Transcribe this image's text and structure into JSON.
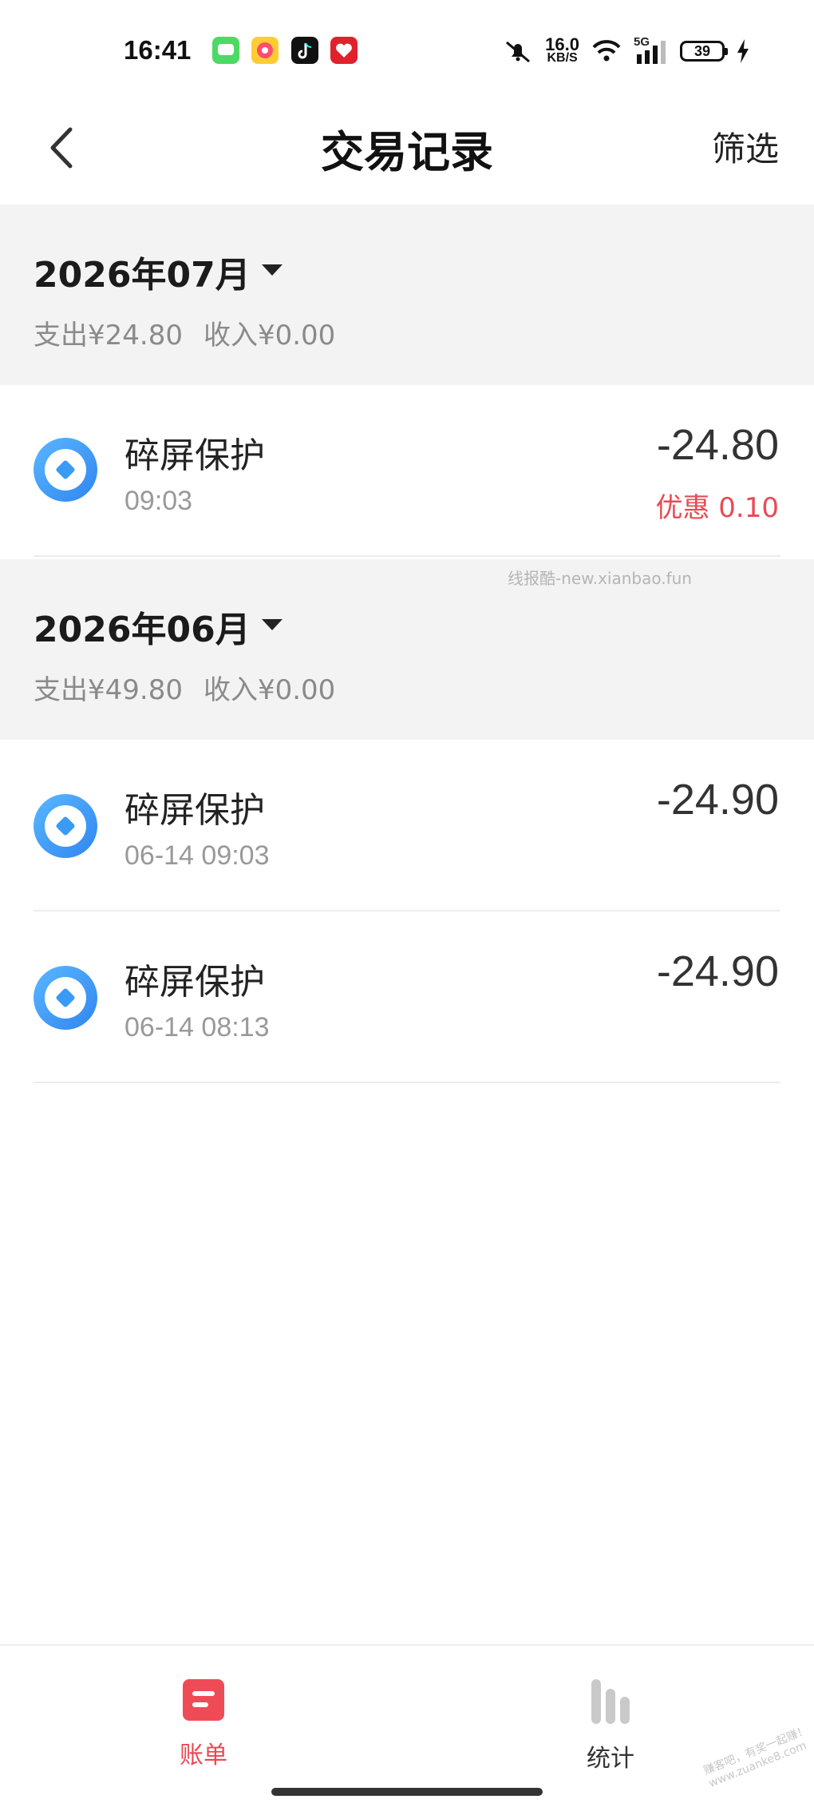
{
  "status_bar": {
    "time": "16:41",
    "net_speed_value": "16.0",
    "net_speed_unit": "KB/S",
    "network": "5G",
    "battery": "39",
    "app_icons": [
      "messages-app-icon",
      "game-app-icon",
      "douyin-app-icon",
      "health-app-icon"
    ]
  },
  "header": {
    "title": "交易记录",
    "filter_label": "筛选"
  },
  "months": [
    {
      "title": "2026年07月",
      "expense": "支出¥24.80",
      "income": "收入¥0.00",
      "transactions": [
        {
          "name": "碎屏保护",
          "time": "09:03",
          "amount": "-24.80",
          "discount": "优惠 0.10"
        }
      ]
    },
    {
      "title": "2026年06月",
      "expense": "支出¥49.80",
      "income": "收入¥0.00",
      "transactions": [
        {
          "name": "碎屏保护",
          "time": "06-14 09:03",
          "amount": "-24.90"
        },
        {
          "name": "碎屏保护",
          "time": "06-14 08:13",
          "amount": "-24.90"
        }
      ]
    }
  ],
  "watermark": "线报酷-new.xianbao.fun",
  "corner_watermark": "赚客吧，有奖一起赚！www.zuanke8.com",
  "tabbar": {
    "bill_label": "账单",
    "stats_label": "统计",
    "active": "bill"
  },
  "colors": {
    "accent_red": "#e84a55",
    "icon_blue": "#3a9bf5",
    "section_bg": "#f3f3f3"
  }
}
